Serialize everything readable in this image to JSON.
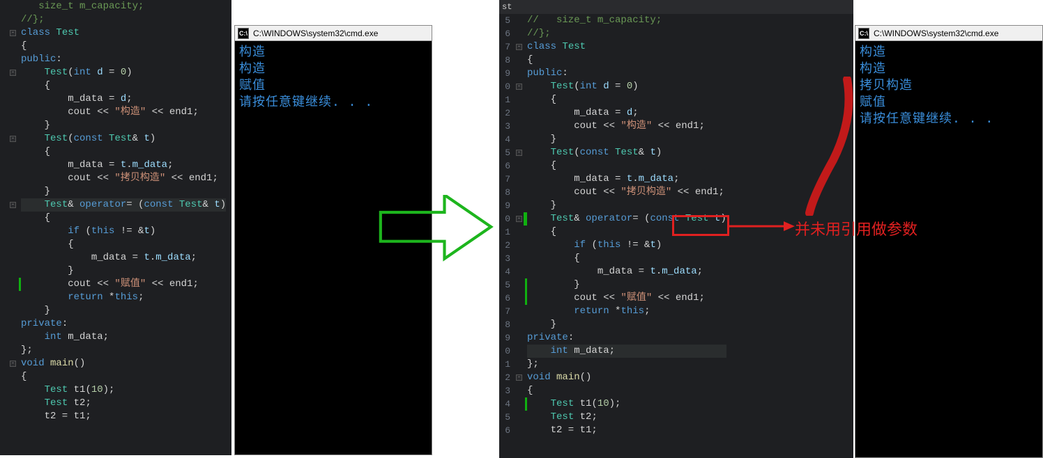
{
  "left": {
    "gutter_numbers": [
      "",
      "",
      "",
      "",
      "",
      "",
      "",
      "",
      "",
      "",
      "",
      "",
      "",
      "",
      "",
      "",
      "",
      "",
      "",
      "",
      "",
      "",
      "",
      "",
      "",
      "",
      "",
      "",
      "",
      "",
      "",
      "",
      ""
    ],
    "code_lines": [
      {
        "frag": [
          [
            "ident",
            "   "
          ],
          [
            "comment",
            "size_t m_capacity;"
          ]
        ]
      },
      {
        "frag": [
          [
            "comment",
            "//};"
          ]
        ]
      },
      {
        "frag": [
          [
            "kw",
            "class"
          ],
          [
            "ident",
            " "
          ],
          [
            "type",
            "Test"
          ]
        ],
        "fold": "-"
      },
      {
        "frag": [
          [
            "punct",
            "{"
          ]
        ]
      },
      {
        "frag": [
          [
            "kw",
            "public"
          ],
          [
            "punct",
            ":"
          ]
        ]
      },
      {
        "frag": [
          [
            "ident",
            "    "
          ],
          [
            "type",
            "Test"
          ],
          [
            "punct",
            "("
          ],
          [
            "kw",
            "int"
          ],
          [
            "ident",
            " "
          ],
          [
            "param",
            "d"
          ],
          [
            "ident",
            " = "
          ],
          [
            "num",
            "0"
          ],
          [
            "punct",
            ")"
          ]
        ],
        "fold": "-"
      },
      {
        "frag": [
          [
            "ident",
            "    "
          ],
          [
            "punct",
            "{"
          ]
        ]
      },
      {
        "frag": [
          [
            "ident",
            "        m_data = "
          ],
          [
            "param",
            "d"
          ],
          [
            "punct",
            ";"
          ]
        ]
      },
      {
        "frag": [
          [
            "ident",
            "        cout << "
          ],
          [
            "str",
            "\"构造\""
          ],
          [
            "ident",
            " << end1"
          ],
          [
            "punct",
            ";"
          ]
        ]
      },
      {
        "frag": [
          [
            "ident",
            "    "
          ],
          [
            "punct",
            "}"
          ]
        ]
      },
      {
        "frag": [
          [
            "ident",
            "    "
          ],
          [
            "type",
            "Test"
          ],
          [
            "punct",
            "("
          ],
          [
            "kw",
            "const"
          ],
          [
            "ident",
            " "
          ],
          [
            "type",
            "Test"
          ],
          [
            "punct",
            "&"
          ],
          [
            "ident",
            " "
          ],
          [
            "param",
            "t"
          ],
          [
            "punct",
            ")"
          ]
        ],
        "fold": "-"
      },
      {
        "frag": [
          [
            "ident",
            "    "
          ],
          [
            "punct",
            "{"
          ]
        ]
      },
      {
        "frag": [
          [
            "ident",
            "        m_data = "
          ],
          [
            "param",
            "t"
          ],
          [
            "ident",
            "."
          ],
          [
            "param",
            "m_data"
          ],
          [
            "punct",
            ";"
          ]
        ]
      },
      {
        "frag": [
          [
            "ident",
            "        cout << "
          ],
          [
            "str",
            "\"拷贝构造\""
          ],
          [
            "ident",
            " << end1"
          ],
          [
            "punct",
            ";"
          ]
        ]
      },
      {
        "frag": [
          [
            "ident",
            "    "
          ],
          [
            "punct",
            "}"
          ]
        ]
      },
      {
        "frag": [
          [
            "ident",
            "    "
          ],
          [
            "type",
            "Test"
          ],
          [
            "punct",
            "&"
          ],
          [
            "ident",
            " "
          ],
          [
            "kw",
            "operator"
          ],
          [
            "ident",
            "= "
          ],
          [
            "punct",
            "("
          ],
          [
            "kw",
            "const"
          ],
          [
            "ident",
            " "
          ],
          [
            "type",
            "Test"
          ],
          [
            "punct",
            "&"
          ],
          [
            "ident",
            " "
          ],
          [
            "param",
            "t"
          ],
          [
            "punct",
            ")"
          ]
        ],
        "hl": true,
        "fold": "-"
      },
      {
        "frag": [
          [
            "ident",
            "    "
          ],
          [
            "punct",
            "{"
          ]
        ]
      },
      {
        "frag": [
          [
            "ident",
            "        "
          ],
          [
            "kw",
            "if"
          ],
          [
            "ident",
            " "
          ],
          [
            "punct",
            "("
          ],
          [
            "kw",
            "this"
          ],
          [
            "ident",
            " != &"
          ],
          [
            "param",
            "t"
          ],
          [
            "punct",
            ")"
          ]
        ]
      },
      {
        "frag": [
          [
            "ident",
            "        "
          ],
          [
            "punct",
            "{"
          ]
        ]
      },
      {
        "frag": [
          [
            "ident",
            "            m_data = "
          ],
          [
            "param",
            "t"
          ],
          [
            "ident",
            "."
          ],
          [
            "param",
            "m_data"
          ],
          [
            "punct",
            ";"
          ]
        ]
      },
      {
        "frag": [
          [
            "ident",
            "        "
          ],
          [
            "punct",
            "}"
          ]
        ]
      },
      {
        "frag": [
          [
            "ident",
            "        cout << "
          ],
          [
            "str",
            "\"赋值\""
          ],
          [
            "ident",
            " << end1"
          ],
          [
            "punct",
            ";"
          ]
        ],
        "gbar": true
      },
      {
        "frag": [
          [
            "ident",
            "        "
          ],
          [
            "kw",
            "return"
          ],
          [
            "ident",
            " *"
          ],
          [
            "kw",
            "this"
          ],
          [
            "punct",
            ";"
          ]
        ]
      },
      {
        "frag": [
          [
            "ident",
            "    "
          ],
          [
            "punct",
            "}"
          ]
        ]
      },
      {
        "frag": [
          [
            "kw",
            "private"
          ],
          [
            "punct",
            ":"
          ]
        ]
      },
      {
        "frag": [
          [
            "ident",
            "    "
          ],
          [
            "kw",
            "int"
          ],
          [
            "ident",
            " m_data"
          ],
          [
            "punct",
            ";"
          ]
        ]
      },
      {
        "frag": [
          [
            "punct",
            "};"
          ]
        ]
      },
      {
        "frag": [
          [
            "kw",
            "void"
          ],
          [
            "ident",
            " "
          ],
          [
            "func",
            "main"
          ],
          [
            "punct",
            "()"
          ]
        ],
        "fold": "-"
      },
      {
        "frag": [
          [
            "punct",
            "{"
          ]
        ]
      },
      {
        "frag": [
          [
            "ident",
            "    "
          ],
          [
            "type",
            "Test"
          ],
          [
            "ident",
            " t1"
          ],
          [
            "punct",
            "("
          ],
          [
            "num",
            "10"
          ],
          [
            "punct",
            ");"
          ]
        ]
      },
      {
        "frag": [
          [
            "ident",
            "    "
          ],
          [
            "type",
            "Test"
          ],
          [
            "ident",
            " t2"
          ],
          [
            "punct",
            ";"
          ]
        ]
      },
      {
        "frag": [
          [
            "ident",
            "    t2 = t1"
          ],
          [
            "punct",
            ";"
          ]
        ]
      }
    ],
    "term": {
      "title": "C:\\WINDOWS\\system32\\cmd.exe",
      "lines": [
        "构造",
        "构造",
        "赋值",
        "请按任意键继续. . ."
      ]
    }
  },
  "right": {
    "tab": "st",
    "line_start": 5,
    "code_lines": [
      {
        "frag": [
          [
            "comment",
            "//   size_t m_capacity;"
          ]
        ]
      },
      {
        "frag": [
          [
            "comment",
            "//};"
          ]
        ]
      },
      {
        "frag": [
          [
            "kw",
            "class"
          ],
          [
            "ident",
            " "
          ],
          [
            "type",
            "Test"
          ]
        ],
        "fold": "-"
      },
      {
        "frag": [
          [
            "punct",
            "{"
          ]
        ]
      },
      {
        "frag": [
          [
            "kw",
            "public"
          ],
          [
            "punct",
            ":"
          ]
        ]
      },
      {
        "frag": [
          [
            "ident",
            "    "
          ],
          [
            "type",
            "Test"
          ],
          [
            "punct",
            "("
          ],
          [
            "kw",
            "int"
          ],
          [
            "ident",
            " "
          ],
          [
            "param",
            "d"
          ],
          [
            "ident",
            " = "
          ],
          [
            "num",
            "0"
          ],
          [
            "punct",
            ")"
          ]
        ],
        "fold": "-"
      },
      {
        "frag": [
          [
            "ident",
            "    "
          ],
          [
            "punct",
            "{"
          ]
        ]
      },
      {
        "frag": [
          [
            "ident",
            "        m_data = "
          ],
          [
            "param",
            "d"
          ],
          [
            "punct",
            ";"
          ]
        ]
      },
      {
        "frag": [
          [
            "ident",
            "        cout << "
          ],
          [
            "str",
            "\"构造\""
          ],
          [
            "ident",
            " << end1"
          ],
          [
            "punct",
            ";"
          ]
        ]
      },
      {
        "frag": [
          [
            "ident",
            "    "
          ],
          [
            "punct",
            "}"
          ]
        ]
      },
      {
        "frag": [
          [
            "ident",
            "    "
          ],
          [
            "type",
            "Test"
          ],
          [
            "punct",
            "("
          ],
          [
            "kw",
            "const"
          ],
          [
            "ident",
            " "
          ],
          [
            "type",
            "Test"
          ],
          [
            "punct",
            "&"
          ],
          [
            "ident",
            " "
          ],
          [
            "param",
            "t"
          ],
          [
            "punct",
            ")"
          ]
        ],
        "fold": "-"
      },
      {
        "frag": [
          [
            "ident",
            "    "
          ],
          [
            "punct",
            "{"
          ]
        ]
      },
      {
        "frag": [
          [
            "ident",
            "        m_data = "
          ],
          [
            "param",
            "t"
          ],
          [
            "ident",
            "."
          ],
          [
            "param",
            "m_data"
          ],
          [
            "punct",
            ";"
          ]
        ]
      },
      {
        "frag": [
          [
            "ident",
            "        cout << "
          ],
          [
            "str",
            "\"拷贝构造\""
          ],
          [
            "ident",
            " << end1"
          ],
          [
            "punct",
            ";"
          ]
        ]
      },
      {
        "frag": [
          [
            "ident",
            "    "
          ],
          [
            "punct",
            "}"
          ]
        ]
      },
      {
        "frag": [
          [
            "ident",
            "    "
          ],
          [
            "type",
            "Test"
          ],
          [
            "punct",
            "&"
          ],
          [
            "ident",
            " "
          ],
          [
            "kw",
            "operator"
          ],
          [
            "ident",
            "= "
          ],
          [
            "punct",
            "("
          ],
          [
            "kw",
            "const"
          ],
          [
            "ident",
            " "
          ],
          [
            "type",
            "Test"
          ],
          [
            "ident",
            " "
          ],
          [
            "param",
            "t"
          ],
          [
            "punct",
            ")"
          ]
        ],
        "fold": "-",
        "gbar2": true
      },
      {
        "frag": [
          [
            "ident",
            "    "
          ],
          [
            "punct",
            "{"
          ]
        ]
      },
      {
        "frag": [
          [
            "ident",
            "        "
          ],
          [
            "kw",
            "if"
          ],
          [
            "ident",
            " "
          ],
          [
            "punct",
            "("
          ],
          [
            "kw",
            "this"
          ],
          [
            "ident",
            " != &"
          ],
          [
            "param",
            "t"
          ],
          [
            "punct",
            ")"
          ]
        ]
      },
      {
        "frag": [
          [
            "ident",
            "        "
          ],
          [
            "punct",
            "{"
          ]
        ]
      },
      {
        "frag": [
          [
            "ident",
            "            m_data = "
          ],
          [
            "param",
            "t"
          ],
          [
            "ident",
            "."
          ],
          [
            "param",
            "m_data"
          ],
          [
            "punct",
            ";"
          ]
        ]
      },
      {
        "frag": [
          [
            "ident",
            "        "
          ],
          [
            "punct",
            "}"
          ]
        ],
        "gbar": true
      },
      {
        "frag": [
          [
            "ident",
            "        cout << "
          ],
          [
            "str",
            "\"赋值\""
          ],
          [
            "ident",
            " << end1"
          ],
          [
            "punct",
            ";"
          ]
        ],
        "gbar": true
      },
      {
        "frag": [
          [
            "ident",
            "        "
          ],
          [
            "kw",
            "return"
          ],
          [
            "ident",
            " *"
          ],
          [
            "kw",
            "this"
          ],
          [
            "punct",
            ";"
          ]
        ]
      },
      {
        "frag": [
          [
            "ident",
            "    "
          ],
          [
            "punct",
            "}"
          ]
        ]
      },
      {
        "frag": [
          [
            "kw",
            "private"
          ],
          [
            "punct",
            ":"
          ]
        ]
      },
      {
        "frag": [
          [
            "ident",
            "    "
          ],
          [
            "kw",
            "int"
          ],
          [
            "ident",
            " m_data"
          ],
          [
            "punct",
            ";"
          ]
        ],
        "hl": true
      },
      {
        "frag": [
          [
            "punct",
            "};"
          ]
        ]
      },
      {
        "frag": [
          [
            "kw",
            "void"
          ],
          [
            "ident",
            " "
          ],
          [
            "func",
            "main"
          ],
          [
            "punct",
            "()"
          ]
        ],
        "fold": "-"
      },
      {
        "frag": [
          [
            "punct",
            "{"
          ]
        ]
      },
      {
        "frag": [
          [
            "ident",
            "    "
          ],
          [
            "type",
            "Test"
          ],
          [
            "ident",
            " t1"
          ],
          [
            "punct",
            "("
          ],
          [
            "num",
            "10"
          ],
          [
            "punct",
            ");"
          ]
        ],
        "gbar": true
      },
      {
        "frag": [
          [
            "ident",
            "    "
          ],
          [
            "type",
            "Test"
          ],
          [
            "ident",
            " t2"
          ],
          [
            "punct",
            ";"
          ]
        ]
      },
      {
        "frag": [
          [
            "ident",
            "    t2 = t1"
          ],
          [
            "punct",
            ";"
          ]
        ]
      }
    ],
    "term": {
      "title": "C:\\WINDOWS\\system32\\cmd.exe",
      "lines": [
        "构造",
        "构造",
        "拷贝构造",
        "赋值",
        "请按任意键继续. . ."
      ]
    }
  },
  "annotation": {
    "red_text": "并未用引用做参数"
  }
}
